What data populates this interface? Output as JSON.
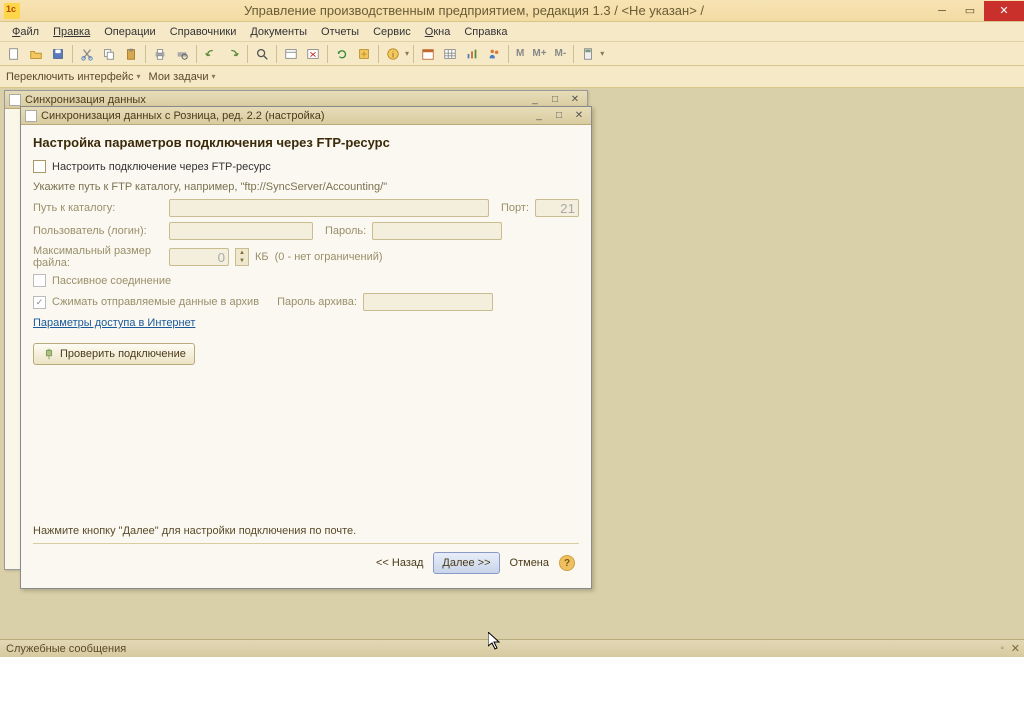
{
  "title": "Управление производственным предприятием, редакция 1.3 / <Не указан> /",
  "menu": {
    "file": "Файл",
    "edit": "Правка",
    "operations": "Операции",
    "catalogs": "Справочники",
    "documents": "Документы",
    "reports": "Отчеты",
    "service": "Сервис",
    "windows": "Окна",
    "help": "Справка"
  },
  "switchbar": {
    "switch_interface": "Переключить интерфейс",
    "my_tasks": "Мои задачи"
  },
  "toolbar_texts": {
    "m": "M",
    "m_plus": "M+",
    "m_minus": "M-"
  },
  "outer_window_title": "Синхронизация данных",
  "dialog": {
    "title": "Синхронизация данных с Розница, ред. 2.2 (настройка)",
    "heading": "Настройка параметров подключения через FTP-ресурс",
    "chk_configure_ftp": "Настроить подключение через FTP-ресурс",
    "hint": "Укажите путь к FTP каталогу, например, \"ftp://SyncServer/Accounting/\"",
    "path_label": "Путь к каталогу:",
    "port_label": "Порт:",
    "port_value": "21",
    "user_label": "Пользователь (логин):",
    "password_label": "Пароль:",
    "max_size_label": "Максимальный размер файла:",
    "max_size_value": "0",
    "max_size_unit": "КБ",
    "max_size_hint": "(0 - нет ограничений)",
    "passive_label": "Пассивное соединение",
    "compress_label": "Сжимать отправляемые данные в архив",
    "archive_pw_label": "Пароль архива:",
    "internet_params_link": "Параметры доступа в Интернет",
    "test_conn": "Проверить подключение",
    "footer_hint": "Нажмите кнопку \"Далее\" для настройки подключения по почте.",
    "back": "<< Назад",
    "next": "Далее >>",
    "cancel": "Отмена"
  },
  "messages_title": "Служебные сообщения"
}
